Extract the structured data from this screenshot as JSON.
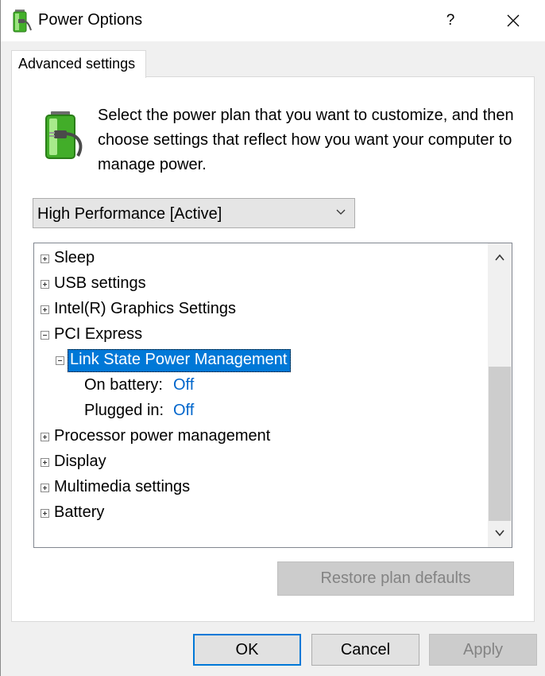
{
  "window": {
    "title": "Power Options",
    "help_label": "?",
    "close_icon": "close-icon"
  },
  "tabs": [
    {
      "label": "Advanced settings",
      "active": true
    }
  ],
  "description": "Select the power plan that you want to customize, and then choose settings that reflect how you want your computer to manage power.",
  "plan_select": {
    "value": "High Performance [Active]"
  },
  "tree": {
    "items": [
      {
        "label": "Sleep",
        "expanded": false
      },
      {
        "label": "USB settings",
        "expanded": false
      },
      {
        "label": "Intel(R) Graphics Settings",
        "expanded": false
      },
      {
        "label": "PCI Express",
        "expanded": true
      },
      {
        "label": "Link State Power Management",
        "expanded": true,
        "selected": true
      },
      {
        "label": "On battery:",
        "value": "Off"
      },
      {
        "label": "Plugged in:",
        "value": "Off"
      },
      {
        "label": "Processor power management",
        "expanded": false
      },
      {
        "label": "Display",
        "expanded": false
      },
      {
        "label": "Multimedia settings",
        "expanded": false
      },
      {
        "label": "Battery",
        "expanded": false
      }
    ]
  },
  "buttons": {
    "restore": "Restore plan defaults",
    "ok": "OK",
    "cancel": "Cancel",
    "apply": "Apply"
  },
  "colors": {
    "selection": "#0078d7",
    "link_value": "#0066cc",
    "disabled_text": "#838383"
  }
}
